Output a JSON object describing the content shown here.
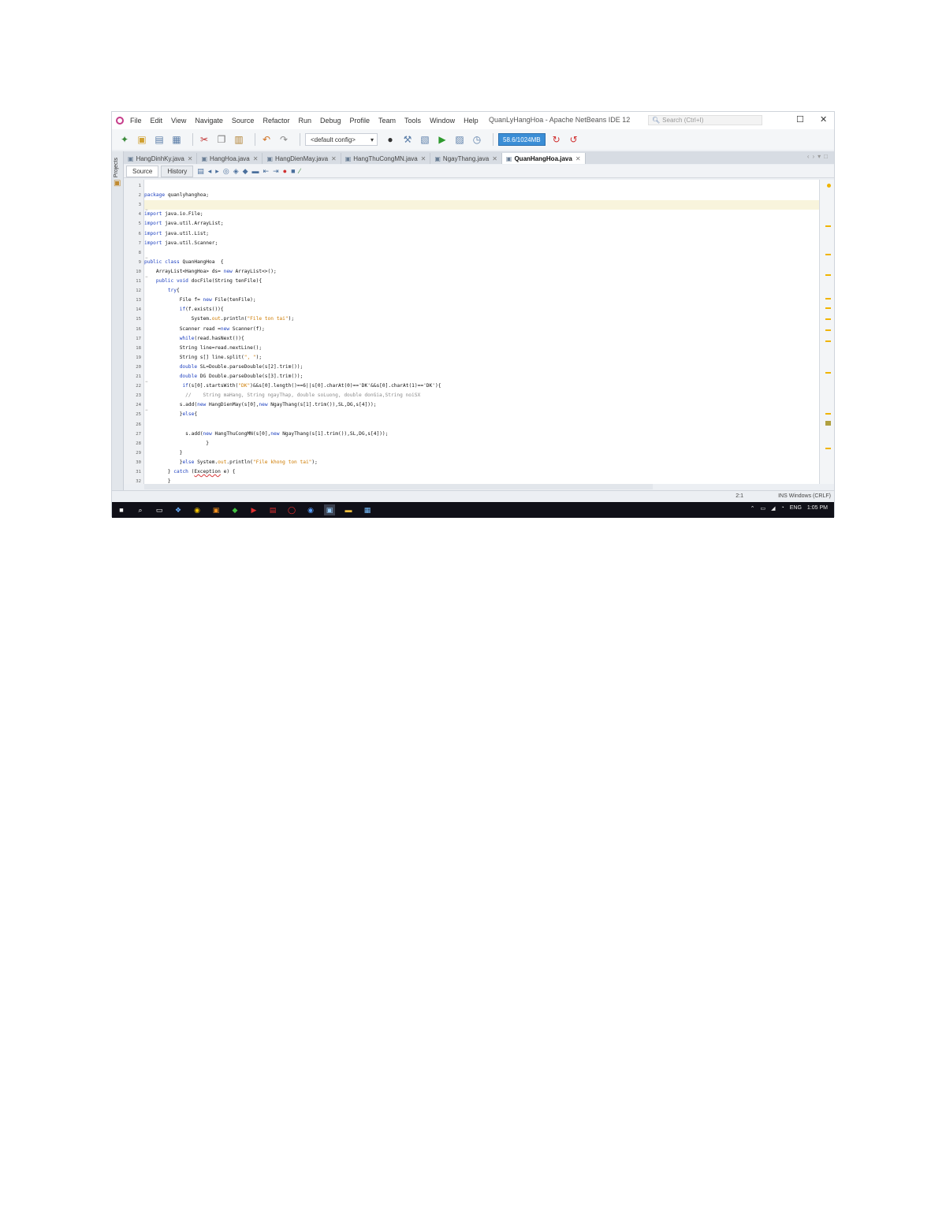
{
  "menu": [
    "File",
    "Edit",
    "View",
    "Navigate",
    "Source",
    "Refactor",
    "Run",
    "Debug",
    "Profile",
    "Team",
    "Tools",
    "Window",
    "Help"
  ],
  "window_title": "QuanLyHangHoa - Apache NetBeans IDE 12",
  "search": {
    "placeholder": "Search (Ctrl+I)"
  },
  "window_controls": {
    "maximize": "☐",
    "close": "✕"
  },
  "toolbar": {
    "config": "<default config>",
    "memory": "58.6/1024MB"
  },
  "side_panel": {
    "label": "Projects"
  },
  "tabs": [
    {
      "label": "HangDinhKy.java",
      "active": false
    },
    {
      "label": "HangHoa.java",
      "active": false
    },
    {
      "label": "HangDienMay.java",
      "active": false
    },
    {
      "label": "HangThuCongMN.java",
      "active": false
    },
    {
      "label": "NgayThang.java",
      "active": false
    },
    {
      "label": "QuanHangHoa.java",
      "active": true
    }
  ],
  "editor_tabs": [
    "Source",
    "History"
  ],
  "code_lines": [
    {
      "n": "1",
      "text": ""
    },
    {
      "n": "2",
      "text": "package quanlyhanghoa;"
    },
    {
      "n": "3",
      "text": ""
    },
    {
      "n": "4",
      "text": "import java.io.File;"
    },
    {
      "n": "5",
      "text": "import java.util.ArrayList;"
    },
    {
      "n": "6",
      "text": "import java.util.List;"
    },
    {
      "n": "7",
      "text": "import java.util.Scanner;"
    },
    {
      "n": "8",
      "text": ""
    },
    {
      "n": "9",
      "text": "public class QuanHangHoa  {"
    },
    {
      "n": "10",
      "text": "    ArrayList<HangHoa> ds= new ArrayList<>();"
    },
    {
      "n": "11",
      "text": "    public void docFile(String tenFile){"
    },
    {
      "n": "12",
      "text": "        try{"
    },
    {
      "n": "13",
      "text": "            File f= new File(tenFile);"
    },
    {
      "n": "14",
      "text": "            if(f.exists()){"
    },
    {
      "n": "15",
      "text": "                System.out.println(\"File ton tai\");"
    },
    {
      "n": "16",
      "text": "            Scanner read =new Scanner(f);"
    },
    {
      "n": "17",
      "text": "            while(read.hasNext()){"
    },
    {
      "n": "18",
      "text": "            String line=read.nextLine();"
    },
    {
      "n": "19",
      "text": "            String s[] line.split(\", \");"
    },
    {
      "n": "20",
      "text": "            double SL=Double.parseDouble(s[2].trim());"
    },
    {
      "n": "21",
      "text": "            double DG Double.parseDouble(s[3].trim());"
    },
    {
      "n": "22",
      "text": "             if(s[0].startsWith(\"DK\")&&s[0].length()==6||s[0].charAt(0)=='DK'&&s[0].charAt(1)=='DK'){"
    },
    {
      "n": "23",
      "text": "              //    String maHang, String ngayThap, double soLuong, double donGia,String noiSX"
    },
    {
      "n": "24",
      "text": "            s.add(new HangDienMay(s[0],new NgayThang(s[1].trim()),SL,DG,s[4]));"
    },
    {
      "n": "25",
      "text": "            }else{"
    },
    {
      "n": "26",
      "text": ""
    },
    {
      "n": "27",
      "text": "              s.add(new HangThuCongMN(s[0],new NgayThang(s[1].trim()),SL,DG,s[4]));"
    },
    {
      "n": "28",
      "text": "                     }"
    },
    {
      "n": "29",
      "text": "            }"
    },
    {
      "n": "30",
      "text": "            }else System.out.println(\"File khong ton tai\");"
    },
    {
      "n": "31",
      "text": "        } catch (Exception e) {"
    },
    {
      "n": "32",
      "text": "        }"
    }
  ],
  "status": {
    "position": "2:1",
    "encoding": "INS Windows (CRLF)"
  },
  "tray": {
    "lang": "ENG",
    "time": "1:05 PM"
  },
  "icons": {
    "app": "netbeans-logo-icon",
    "search": "magnifier-icon",
    "projects": "folder-icon"
  }
}
